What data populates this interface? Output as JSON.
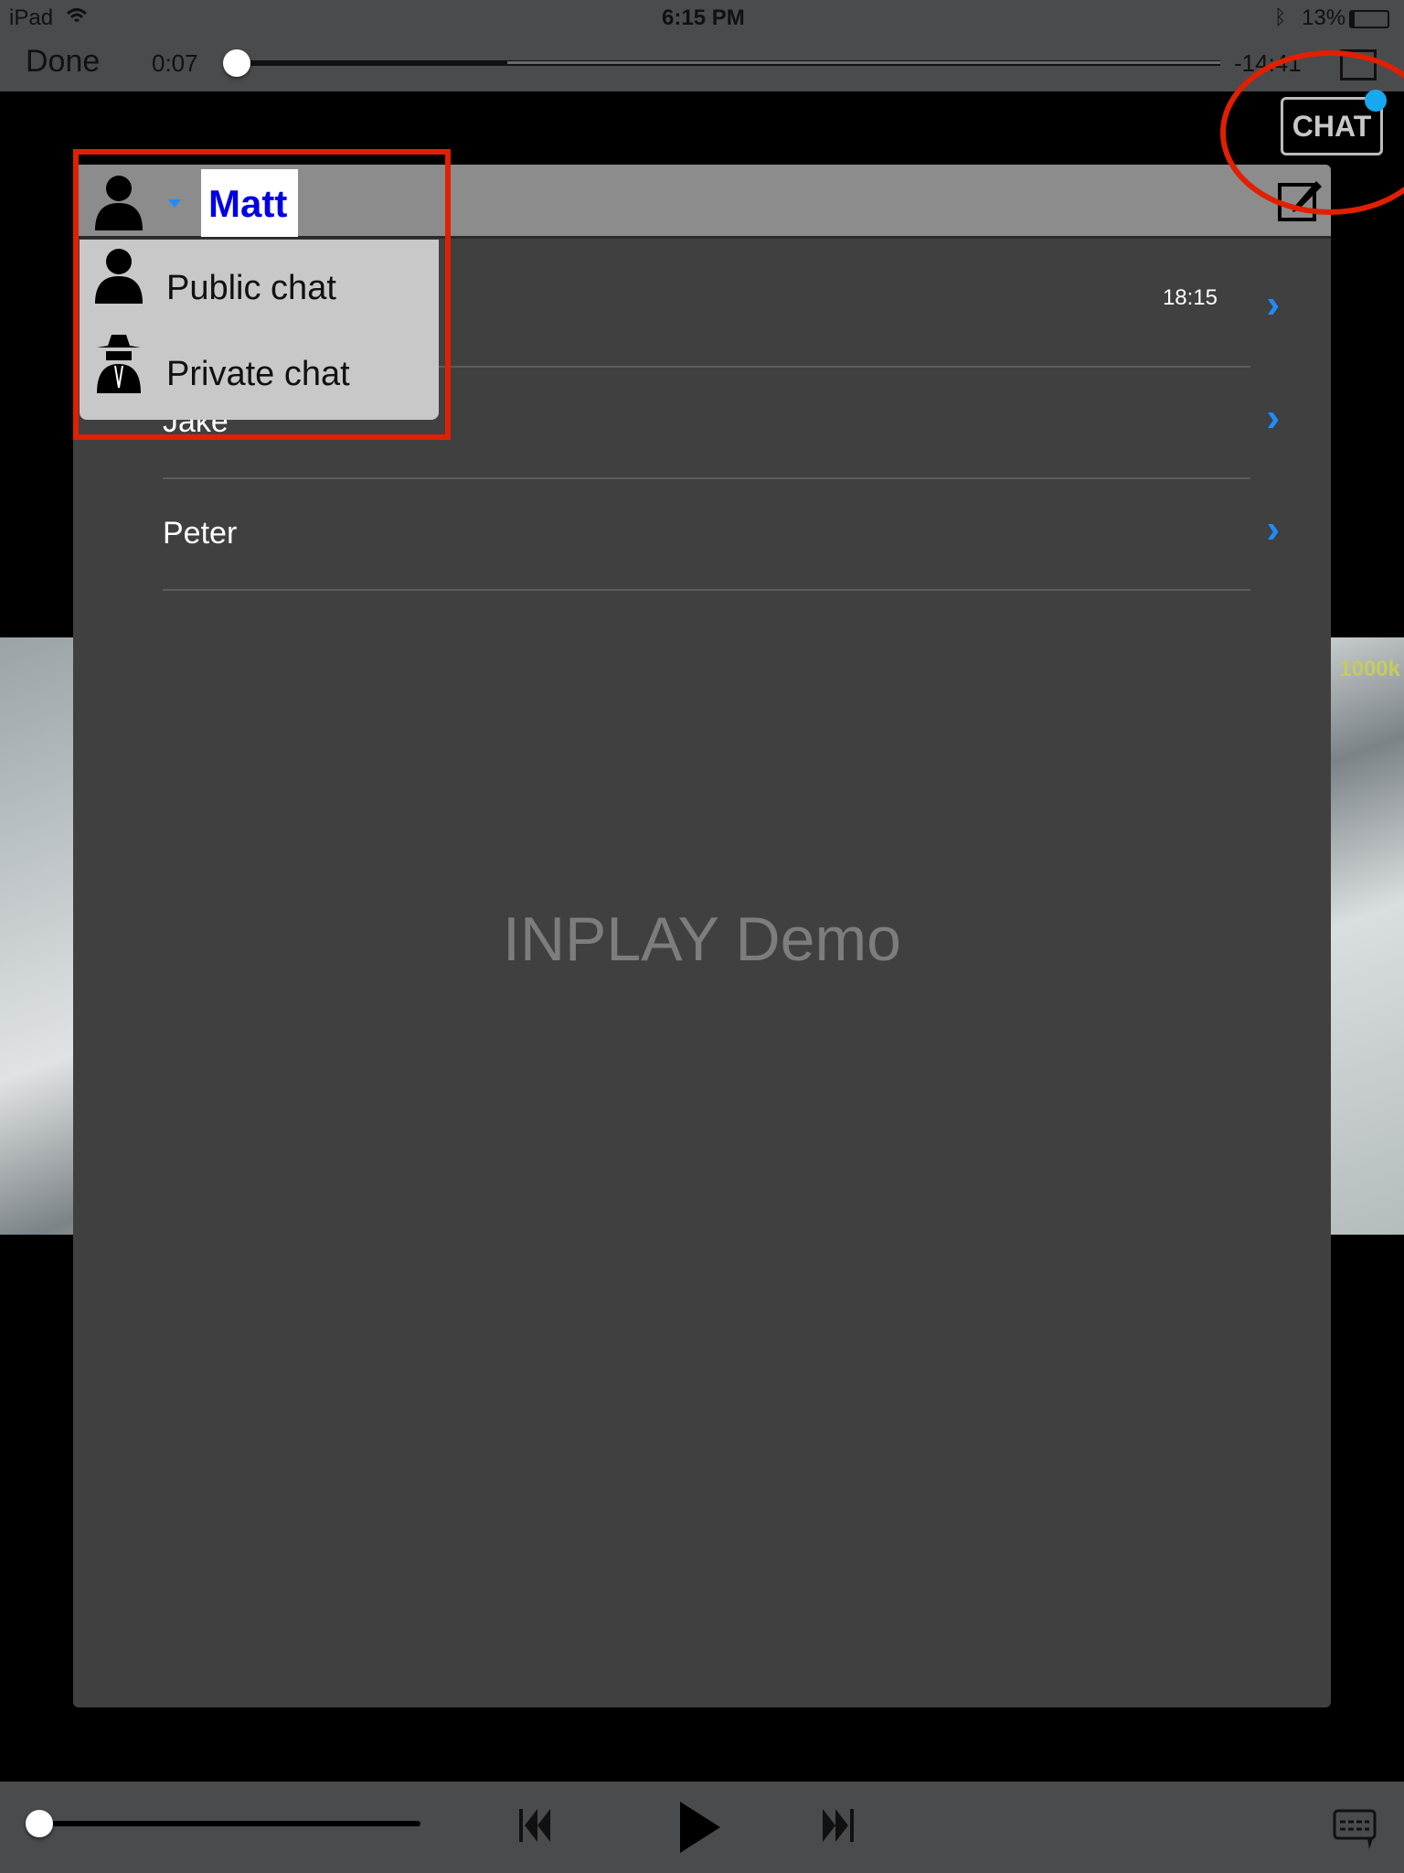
{
  "status_bar": {
    "device": "iPad",
    "time": "6:15 PM",
    "battery": "13%"
  },
  "player": {
    "done_label": "Done",
    "elapsed": "0:07",
    "remaining": "-14:41",
    "progress_fraction": 0.005,
    "volume_fraction": 0.0
  },
  "video": {
    "bitrate_overlay": "1000k"
  },
  "chat_button": {
    "label": "CHAT",
    "unread_dot_color": "#16a9f0"
  },
  "chat_panel": {
    "user_name": "Matt",
    "mode_menu": [
      {
        "label": "Public chat",
        "icon": "person-icon"
      },
      {
        "label": "Private chat",
        "icon": "spy-icon"
      }
    ],
    "conversations": [
      {
        "name": "",
        "time": "18:15"
      },
      {
        "name": "Jake",
        "time": ""
      },
      {
        "name": "Peter",
        "time": ""
      }
    ],
    "watermark": "INPLAY Demo"
  },
  "colors": {
    "annotation": "#e02000",
    "accent": "#1e8bff",
    "name": "#0000e6"
  }
}
